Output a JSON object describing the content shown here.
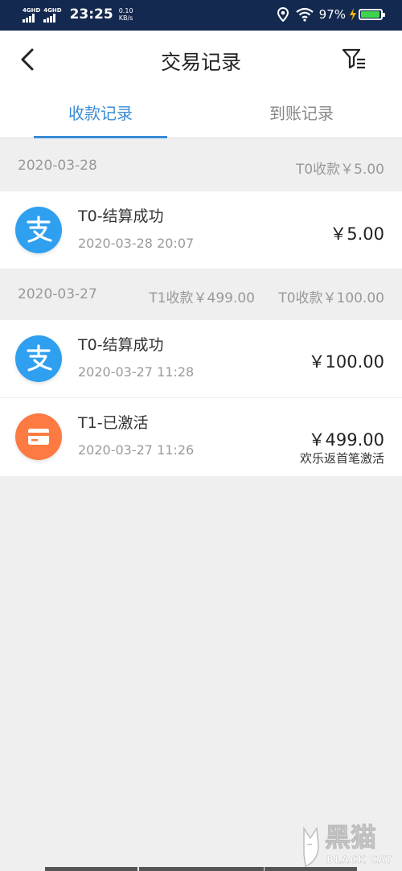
{
  "status_bar": {
    "network_1": "4GHD",
    "network_2": "4GHD",
    "time": "23:25",
    "speed_value": "0.10",
    "speed_unit": "KB/s",
    "battery_percent": "97%",
    "battery_color": "#3ed54c"
  },
  "nav": {
    "title": "交易记录",
    "back_icon": "chevron-left-icon",
    "filter_icon": "filter-list-icon"
  },
  "tabs": [
    {
      "label": "收款记录",
      "active": true
    },
    {
      "label": "到账记录",
      "active": false
    }
  ],
  "accent_color": "#3a8cd6",
  "groups": [
    {
      "date": "2020-03-28",
      "summaries": [
        "T0收款￥5.00"
      ],
      "records": [
        {
          "icon": "alipay-icon",
          "title": "T0-结算成功",
          "time": "2020-03-28 20:07",
          "amount": "￥5.00"
        }
      ]
    },
    {
      "date": "2020-03-27",
      "summaries": [
        "T1收款￥499.00",
        "T0收款￥100.00"
      ],
      "records": [
        {
          "icon": "alipay-icon",
          "title": "T0-结算成功",
          "time": "2020-03-27 11:28",
          "amount": "￥100.00"
        },
        {
          "icon": "card-icon",
          "title": "T1-已激活",
          "time": "2020-03-27 11:26",
          "amount": "￥499.00",
          "note": "欢乐返首笔激活"
        }
      ]
    }
  ],
  "watermark": {
    "brand_cn": "黑猫",
    "brand_en": "BLACK CAT"
  }
}
